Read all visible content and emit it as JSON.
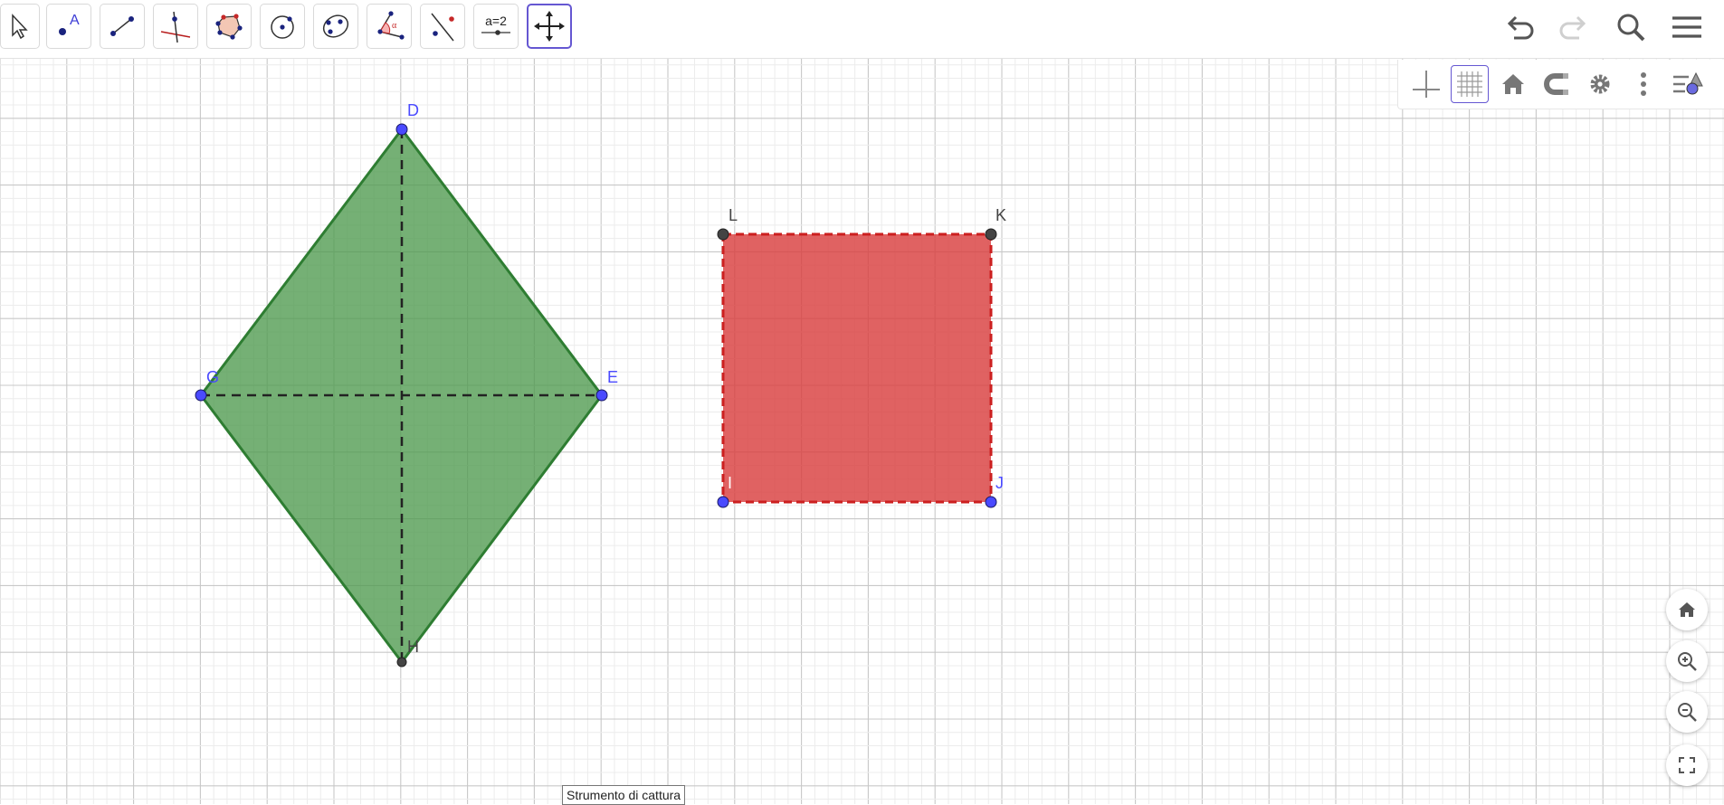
{
  "toolbar": {
    "tools": [
      {
        "id": "move",
        "icon": "cursor-arrow-icon"
      },
      {
        "id": "point",
        "icon": "point-icon",
        "label": "A"
      },
      {
        "id": "segment",
        "icon": "segment-icon"
      },
      {
        "id": "perpendicular",
        "icon": "perpendicular-line-icon"
      },
      {
        "id": "polygon",
        "icon": "polygon-icon"
      },
      {
        "id": "circle",
        "icon": "circle-center-point-icon"
      },
      {
        "id": "conic",
        "icon": "ellipse-icon"
      },
      {
        "id": "angle",
        "icon": "angle-icon",
        "label": "α"
      },
      {
        "id": "reflect",
        "icon": "reflect-line-icon"
      },
      {
        "id": "slider",
        "icon": "slider-icon",
        "label": "a=2"
      },
      {
        "id": "move-view",
        "icon": "move-graphics-view-icon",
        "active": true
      }
    ],
    "right": [
      "undo-icon",
      "redo-icon",
      "search-icon",
      "menu-icon"
    ]
  },
  "stylebar": [
    "axes-icon",
    "grid-icon",
    "home-icon",
    "magnet-icon",
    "settings-icon",
    "more-icon",
    "algebra-view-icon"
  ],
  "view_buttons": [
    "home-icon",
    "zoom-in-icon",
    "zoom-out-icon",
    "fullscreen-icon"
  ],
  "points": {
    "D": {
      "label": "D",
      "color": "#4a4aff"
    },
    "E": {
      "label": "E",
      "color": "#4a4aff"
    },
    "G": {
      "label": "G",
      "color": "#4a4aff"
    },
    "H": {
      "label": "H",
      "color": "#444444"
    },
    "L": {
      "label": "L",
      "color": "#444444"
    },
    "K": {
      "label": "K",
      "color": "#444444"
    },
    "I": {
      "label": "I",
      "color": "#4a4aff"
    },
    "J": {
      "label": "J",
      "color": "#4a4aff"
    }
  },
  "colors": {
    "rhombus_fill": "#4e9a4e",
    "rhombus_stroke": "#2e7d32",
    "square_fill": "#e04848",
    "square_stroke": "#d32f2f",
    "accent": "#6557d2"
  },
  "tooltip": "Strumento di cattura"
}
